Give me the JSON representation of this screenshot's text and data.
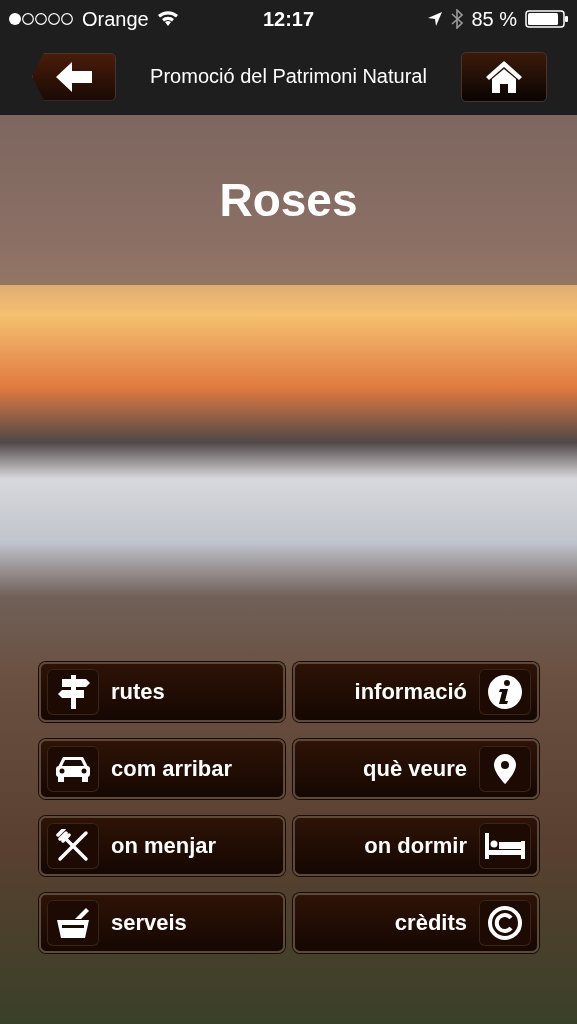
{
  "status_bar": {
    "carrier": "Orange",
    "time": "12:17",
    "battery": "85 %"
  },
  "nav_bar": {
    "title": "Promoció del Patrimoni Natural"
  },
  "header": {
    "title": "Roses"
  },
  "menu": [
    {
      "label": "rutes"
    },
    {
      "label": "informació"
    },
    {
      "label": "com arribar"
    },
    {
      "label": "què veure"
    },
    {
      "label": "on menjar"
    },
    {
      "label": "on dormir"
    },
    {
      "label": "serveis"
    },
    {
      "label": "crèdits"
    }
  ]
}
